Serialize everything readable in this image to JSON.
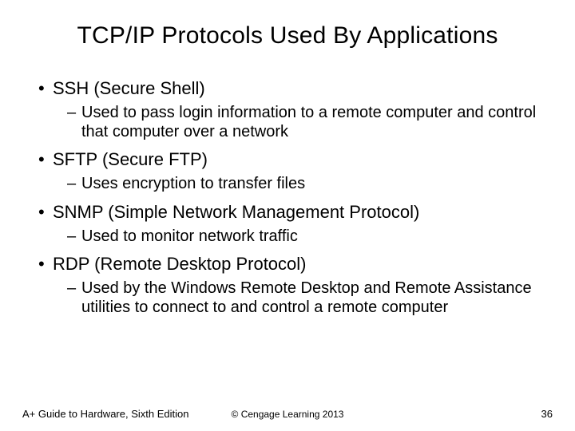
{
  "title": "TCP/IP Protocols Used By Applications",
  "items": [
    {
      "heading": "SSH (Secure Shell)",
      "sub": "Used to pass login information to a remote computer and control that computer over a network"
    },
    {
      "heading": "SFTP (Secure FTP)",
      "sub": "Uses encryption to transfer files"
    },
    {
      "heading": "SNMP (Simple Network Management Protocol)",
      "sub": "Used to monitor network traffic"
    },
    {
      "heading": "RDP (Remote Desktop Protocol)",
      "sub": "Used by the Windows Remote Desktop and Remote Assistance utilities to connect to and control a remote computer"
    }
  ],
  "footer": {
    "left": "A+ Guide to Hardware, Sixth Edition",
    "center": "© Cengage Learning  2013",
    "right": "36"
  }
}
